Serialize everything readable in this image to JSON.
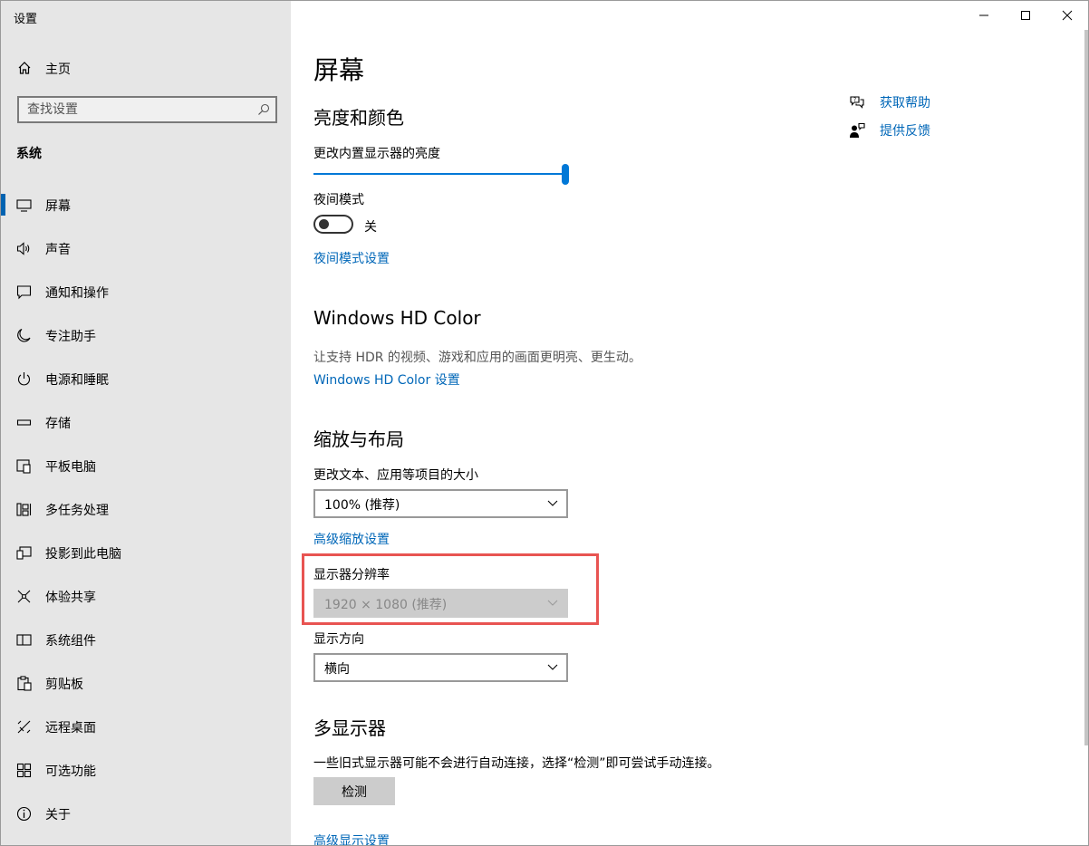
{
  "app_title": "设置",
  "sidebar": {
    "home_label": "主页",
    "search_placeholder": "查找设置",
    "group_title": "系统",
    "items": [
      {
        "label": "屏幕",
        "icon": "monitor-icon"
      },
      {
        "label": "声音",
        "icon": "speaker-icon"
      },
      {
        "label": "通知和操作",
        "icon": "message-icon"
      },
      {
        "label": "专注助手",
        "icon": "moon-icon"
      },
      {
        "label": "电源和睡眠",
        "icon": "power-icon"
      },
      {
        "label": "存储",
        "icon": "storage-icon"
      },
      {
        "label": "平板电脑",
        "icon": "tablet-icon"
      },
      {
        "label": "多任务处理",
        "icon": "multitask-icon"
      },
      {
        "label": "投影到此电脑",
        "icon": "project-icon"
      },
      {
        "label": "体验共享",
        "icon": "share-icon"
      },
      {
        "label": "系统组件",
        "icon": "components-icon"
      },
      {
        "label": "剪贴板",
        "icon": "clipboard-icon"
      },
      {
        "label": "远程桌面",
        "icon": "remote-icon"
      },
      {
        "label": "可选功能",
        "icon": "features-icon"
      },
      {
        "label": "关于",
        "icon": "info-icon"
      }
    ]
  },
  "main": {
    "page_title": "屏幕",
    "brightness": {
      "heading": "亮度和颜色",
      "slider_label": "更改内置显示器的亮度",
      "slider_value": 1.0
    },
    "night_mode": {
      "label": "夜间模式",
      "state": "关",
      "settings_link": "夜间模式设置"
    },
    "hdr": {
      "heading": "Windows HD Color",
      "description": "让支持 HDR 的视频、游戏和应用的画面更明亮、更生动。",
      "settings_link": "Windows HD Color 设置"
    },
    "scale": {
      "heading": "缩放与布局",
      "size_label": "更改文本、应用等项目的大小",
      "size_value": "100% (推荐)",
      "advanced_link": "高级缩放设置",
      "resolution_label": "显示器分辨率",
      "resolution_value": "1920 × 1080 (推荐)",
      "orientation_label": "显示方向",
      "orientation_value": "横向"
    },
    "multi": {
      "heading": "多显示器",
      "description": "一些旧式显示器可能不会进行自动连接，选择“检测”即可尝试手动连接。",
      "detect_button": "检测",
      "advanced_link": "高级显示设置"
    },
    "help": {
      "get_help": "获取帮助",
      "feedback": "提供反馈"
    }
  },
  "colors": {
    "accent": "#0078d7",
    "link": "#0067b8",
    "highlight_border": "#e85452",
    "sidebar_bg": "#e6e6e6"
  }
}
